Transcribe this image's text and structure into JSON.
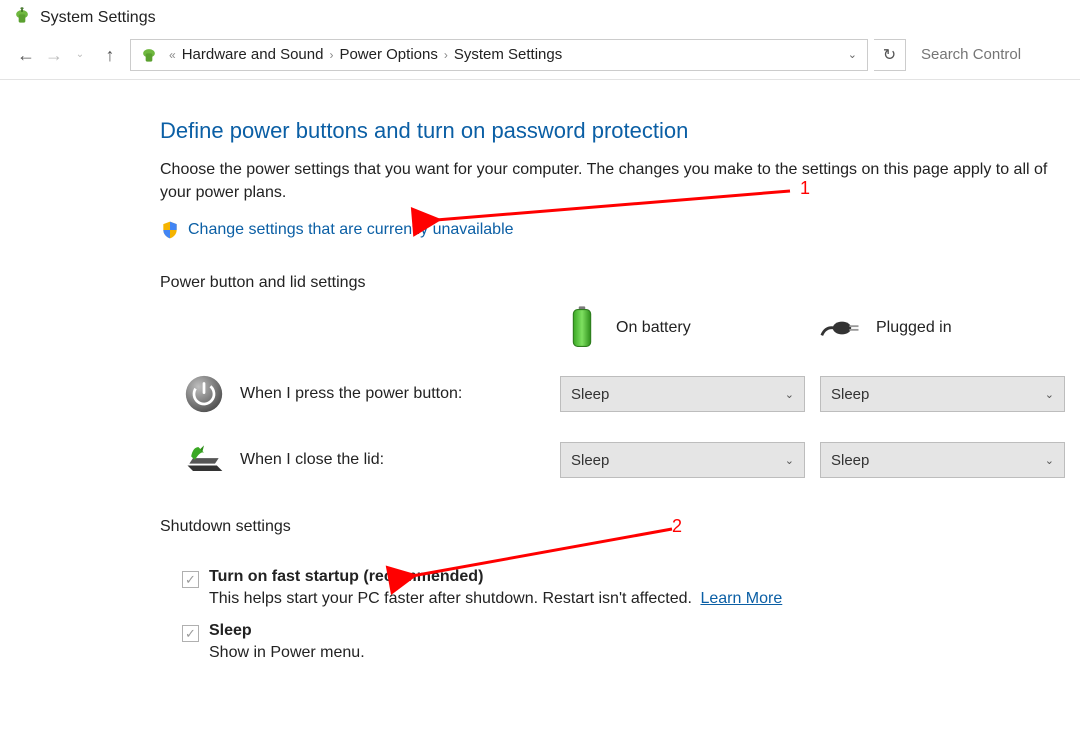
{
  "window_title": "System Settings",
  "breadcrumb": {
    "seg1": "Hardware and Sound",
    "seg2": "Power Options",
    "seg3": "System Settings",
    "ellipsis": "«"
  },
  "search_placeholder": "Search Control",
  "heading": "Define power buttons and turn on password protection",
  "subtext": "Choose the power settings that you want for your computer. The changes you make to the settings on this page apply to all of your power plans.",
  "change_link": "Change settings that are currently unavailable",
  "section_power_lid": "Power button and lid settings",
  "col_battery": "On battery",
  "col_plugged": "Plugged in",
  "row_power_button": "When I press the power button:",
  "row_close_lid": "When I close the lid:",
  "combo_value": "Sleep",
  "section_shutdown": "Shutdown settings",
  "fast_startup_label": "Turn on fast startup (recommended)",
  "fast_startup_desc": "This helps start your PC faster after shutdown. Restart isn't affected.",
  "learn_more": "Learn More",
  "sleep_label": "Sleep",
  "sleep_desc": "Show in Power menu.",
  "annotation": {
    "one": "1",
    "two": "2"
  }
}
